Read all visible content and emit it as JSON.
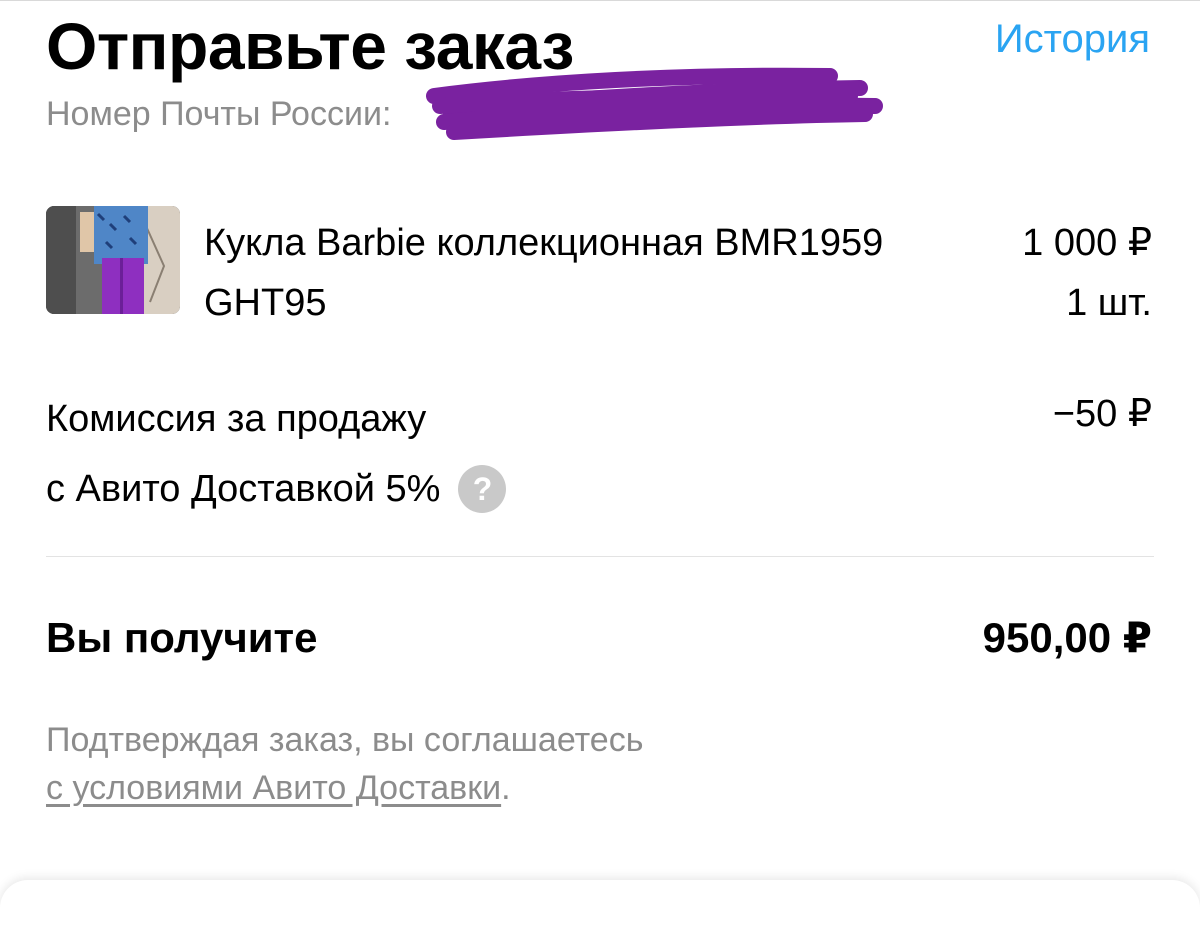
{
  "header": {
    "title": "Отправьте заказ",
    "history_link": "История",
    "post_number_label": "Номер Почты России:"
  },
  "product": {
    "name": "Кукла Barbie коллекционная BMR1959 GHT95",
    "price": "1 000 ₽",
    "quantity": "1 шт."
  },
  "fee": {
    "label_line1": "Комиссия за продажу",
    "label_line2": "с Авито Доставкой 5%",
    "amount": "−50 ₽",
    "help_icon": "question-mark-icon"
  },
  "total": {
    "label": "Вы получите",
    "amount": "950,00 ₽"
  },
  "agreement": {
    "text": "Подтверждая заказ, вы соглашаетесь",
    "link": "с условиями Авито Доставки",
    "suffix": "."
  },
  "colors": {
    "accent_link": "#2aa4f2",
    "secondary_text": "#8c8c8c",
    "redaction": "#7a22a0",
    "help_icon_bg": "#c9c9c9"
  }
}
